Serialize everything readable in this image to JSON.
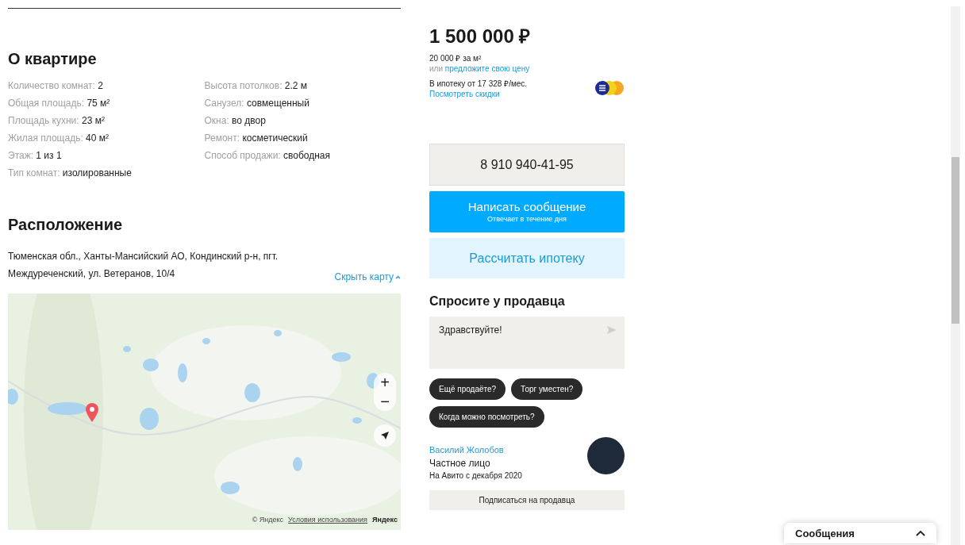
{
  "about": {
    "title": "О квартире",
    "params": [
      {
        "label": "Количество комнат:",
        "value": "2"
      },
      {
        "label": "Высота потолков:",
        "value": "2.2 м"
      },
      {
        "label": "Общая площадь:",
        "value": "75 м²"
      },
      {
        "label": "Санузел:",
        "value": "совмещенный"
      },
      {
        "label": "Площадь кухни:",
        "value": "23 м²"
      },
      {
        "label": "Окна:",
        "value": "во двор"
      },
      {
        "label": "Жилая площадь:",
        "value": "40 м²"
      },
      {
        "label": "Ремонт:",
        "value": "косметический"
      },
      {
        "label": "Этаж:",
        "value": "1 из 1"
      },
      {
        "label": "Способ продажи:",
        "value": "свободная"
      },
      {
        "label": "Тип комнат:",
        "value": "изолированные"
      }
    ]
  },
  "location": {
    "title": "Расположение",
    "address": "Тюменская обл., Ханты-Мансийский АО, Кондинский р-н, пгт. Междуреченский, ул. Ветеранов, 10/4",
    "toggle": "Скрыть карту",
    "map": {
      "zoom_in": "+",
      "zoom_out": "−",
      "copyright": "© Яндекс",
      "terms": "Условия использования",
      "logo": "Яндекс"
    }
  },
  "price": {
    "amount": "1 500 000 ₽",
    "per_meter": "20 000 ₽ за м²",
    "offer_prefix": "или",
    "offer_link": "предложите свою цену",
    "mortgage": "В ипотеку от 17 328 ₽/мес.",
    "discounts": "Посмотреть скидки"
  },
  "phone": "8 910 940-41-95",
  "message_button": {
    "label": "Написать сообщение",
    "sub": "Отвечает в течение дня"
  },
  "mortgage_button": "Рассчитать ипотеку",
  "ask": {
    "title": "Спросите у продавца",
    "input": "Здравствуйте!",
    "chips": [
      "Ещё продаёте?",
      "Торг уместен?",
      "Когда можно посмотреть?"
    ]
  },
  "seller": {
    "name": "Василий Жолобов",
    "type": "Частное лицо",
    "since": "На Авито с декабря 2020",
    "subscribe": "Подписаться на продавца"
  },
  "messages_widget": {
    "title": "Сообщения"
  }
}
